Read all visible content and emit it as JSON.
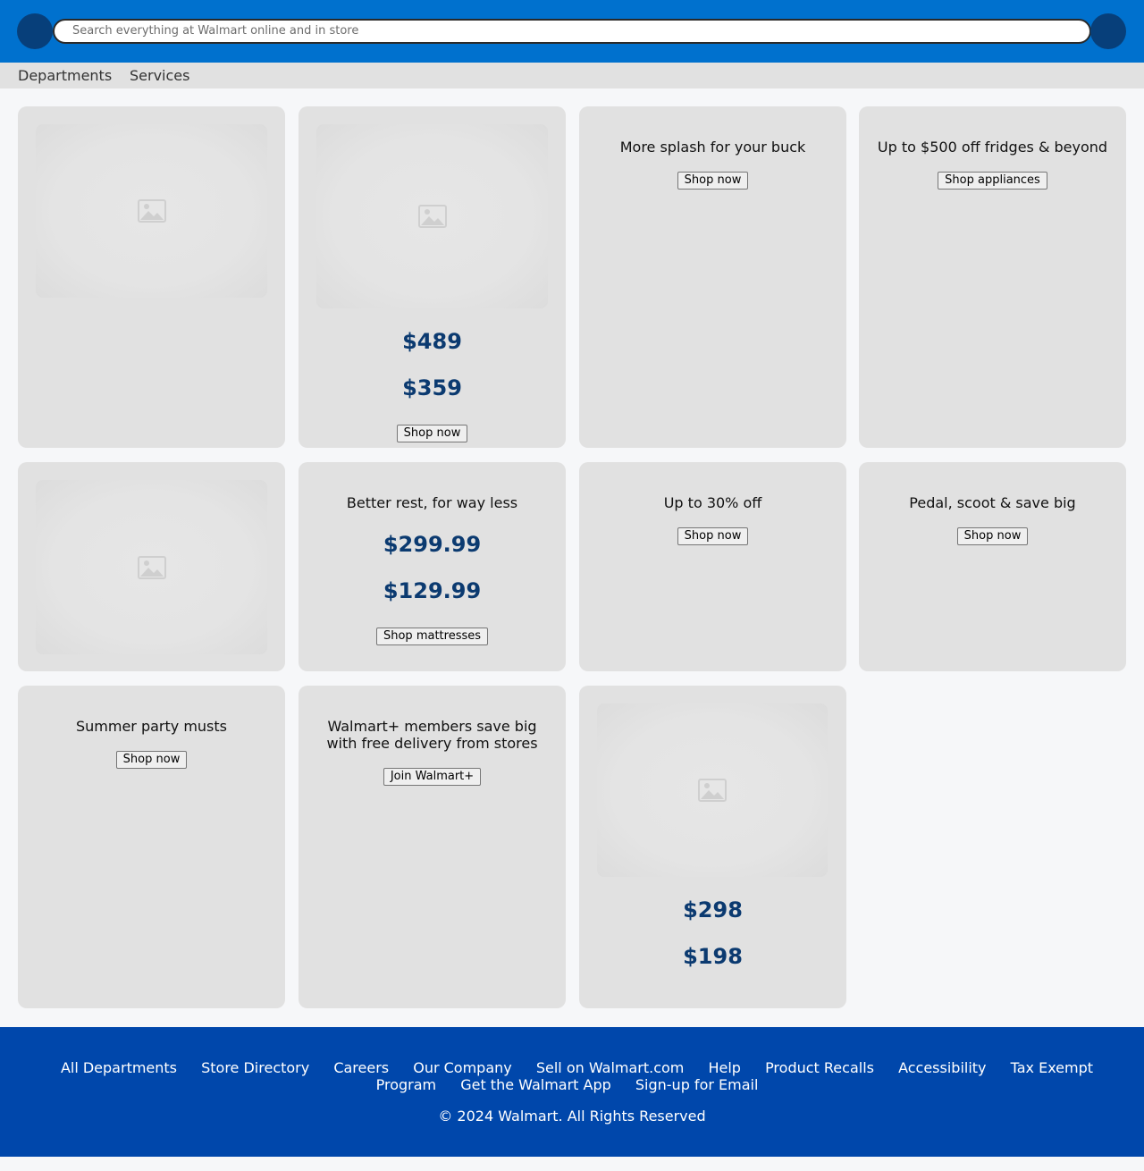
{
  "header": {
    "search_placeholder": "Search everything at Walmart online and in store"
  },
  "nav": {
    "items": [
      {
        "label": "Departments"
      },
      {
        "label": "Services"
      }
    ]
  },
  "cards": [
    {
      "prices": []
    },
    {
      "prices": [
        "$489",
        "$359"
      ],
      "button": "Shop now"
    },
    {
      "title": "More splash for your buck",
      "button": "Shop now"
    },
    {
      "title": "Up to $500 off fridges & beyond",
      "button": "Shop appliances"
    },
    {
      "prices": []
    },
    {
      "title": "Better rest, for way less",
      "prices": [
        "$299.99",
        "$129.99"
      ],
      "button": "Shop mattresses"
    },
    {
      "title": "Up to 30% off",
      "button": "Shop now"
    },
    {
      "title": "Pedal, scoot & save big",
      "button": "Shop now"
    },
    {
      "title": "Summer party musts",
      "button": "Shop now"
    },
    {
      "title_line1": "Walmart+ members save big",
      "title_line2": "with free delivery from stores",
      "button": "Join Walmart+"
    },
    {
      "prices": [
        "$298",
        "$198"
      ]
    }
  ],
  "footer": {
    "links": [
      {
        "label": "All Departments"
      },
      {
        "label": "Store Directory"
      },
      {
        "label": "Careers"
      },
      {
        "label": "Our Company"
      },
      {
        "label": "Sell on Walmart.com"
      },
      {
        "label": "Help"
      },
      {
        "label": "Product Recalls"
      },
      {
        "label": "Accessibility"
      },
      {
        "label": "Tax Exempt Program"
      },
      {
        "label": "Get the Walmart App"
      },
      {
        "label": "Sign-up for Email"
      }
    ],
    "copyright": "© 2024 Walmart. All Rights Reserved"
  },
  "colors": {
    "header_bg": "#0071ce",
    "footer_bg": "#0047ab",
    "price_color": "#0b3a70"
  },
  "icons": [
    "menu-icon",
    "cart-icon",
    "image-placeholder-icon"
  ]
}
